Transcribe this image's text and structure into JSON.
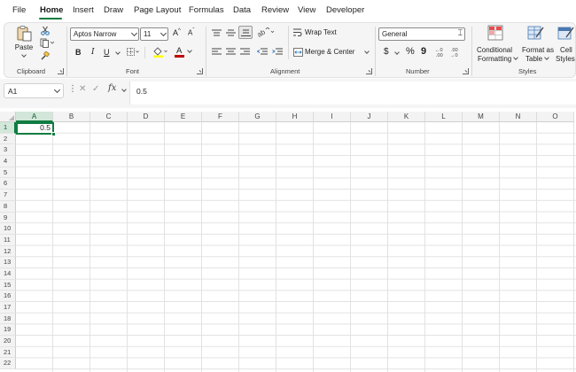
{
  "menu": {
    "tabs": [
      "File",
      "Home",
      "Insert",
      "Draw",
      "Page Layout",
      "Formulas",
      "Data",
      "Review",
      "View",
      "Developer"
    ],
    "active": "Home"
  },
  "ribbon": {
    "clipboard": {
      "paste_label": "Paste",
      "group_label": "Clipboard"
    },
    "font": {
      "font_name": "Aptos Narrow",
      "font_size": "11",
      "grow_label": "A^",
      "shrink_label": "Aˇ",
      "bold": "B",
      "italic": "I",
      "underline": "U",
      "font_color_label": "A",
      "group_label": "Font"
    },
    "alignment": {
      "wrap_text": "Wrap Text",
      "merge_center": "Merge & Center",
      "group_label": "Alignment"
    },
    "number": {
      "format": "General",
      "currency": "$",
      "percent": "%",
      "comma": "9",
      "group_label": "Number"
    },
    "styles": {
      "conditional_formatting": [
        "Conditional",
        "Formatting"
      ],
      "format_as_table": [
        "Format as",
        "Table"
      ],
      "cell_styles": [
        "Cell",
        "Styles"
      ],
      "group_label": "Styles"
    }
  },
  "formula_bar": {
    "name_box": "A1",
    "fx": "fx",
    "content": "0.5"
  },
  "sheet": {
    "columns": [
      "A",
      "B",
      "C",
      "D",
      "E",
      "F",
      "G",
      "H",
      "I",
      "J",
      "K",
      "L",
      "M",
      "N",
      "O"
    ],
    "rows": [
      "1",
      "2",
      "3",
      "4",
      "5",
      "6",
      "7",
      "8",
      "9",
      "10",
      "11",
      "12",
      "13",
      "14",
      "15",
      "16",
      "17",
      "18",
      "19",
      "20",
      "21",
      "22"
    ],
    "selected_cell": "A1",
    "a1_value": "0.5"
  },
  "colors": {
    "accent": "#107c41",
    "ribbon_bg": "#f5f5f5",
    "font_color_bar": "#c00000",
    "highlight_bar": "#ffff00"
  }
}
